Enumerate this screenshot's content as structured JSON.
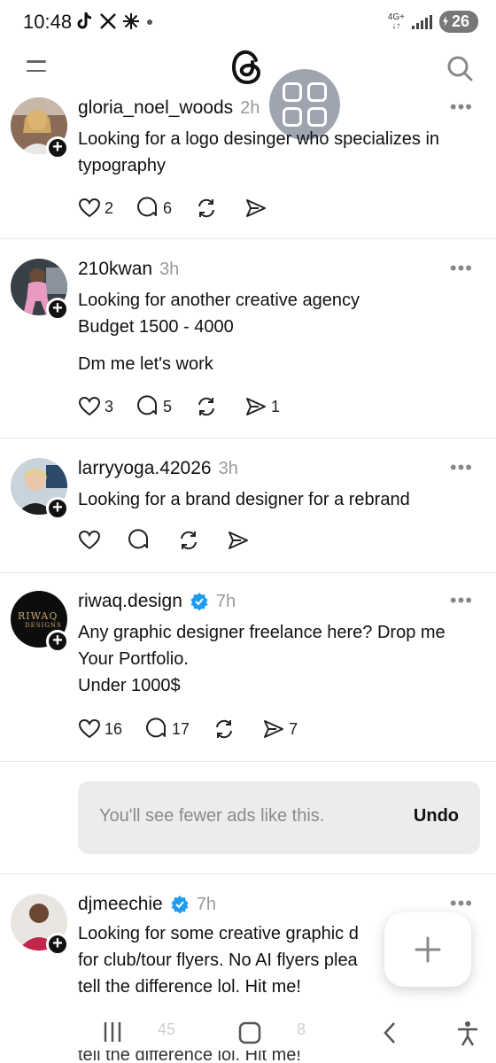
{
  "status_bar": {
    "time": "10:48",
    "network": "4G+",
    "battery": "26"
  },
  "header": {
    "logo_icon": "threads-logo-icon",
    "menu_icon": "hamburger-icon",
    "search_icon": "search-icon"
  },
  "posts": [
    {
      "username": "gloria_noel_woods",
      "time": "2h",
      "verified": false,
      "text": [
        "Looking for a logo desinger who specializes in typography"
      ],
      "likes": "2",
      "comments": "6",
      "reposts": "",
      "shares": ""
    },
    {
      "username": "210kwan",
      "time": "3h",
      "verified": false,
      "text": [
        "Looking for another creative agency",
        "Budget 1500 - 4000",
        "Dm me let's work"
      ],
      "likes": "3",
      "comments": "5",
      "reposts": "",
      "shares": "1"
    },
    {
      "username": "larryyoga.42026",
      "time": "3h",
      "verified": false,
      "text": [
        "Looking for a brand designer for a rebrand"
      ],
      "likes": "",
      "comments": "",
      "reposts": "",
      "shares": ""
    },
    {
      "username": "riwaq.design",
      "time": "7h",
      "verified": true,
      "avatar_text": "RIWAQ",
      "avatar_subtext": "DESIGNS",
      "text": [
        "Any graphic designer freelance here? Drop me Your Portfolio.",
        "Under 1000$"
      ],
      "likes": "16",
      "comments": "17",
      "reposts": "",
      "shares": "7"
    },
    {
      "username": "djmeechie",
      "time": "7h",
      "verified": true,
      "text_lines": [
        "Looking for some creative graphic d",
        "for club/tour flyers. No AI flyers plea",
        "tell the difference lol. Hit me!"
      ],
      "likes": "",
      "comments": "45",
      "reposts": "",
      "shares": "8"
    }
  ],
  "ad_notice": {
    "message": "You'll see fewer ads like this.",
    "undo_label": "Undo"
  },
  "cut_text": "tell the difference lol. Hit me!",
  "colors": {
    "verified": "#1d9bf0",
    "text": "#111111",
    "muted": "#999999",
    "ad_bg": "#ececec"
  }
}
